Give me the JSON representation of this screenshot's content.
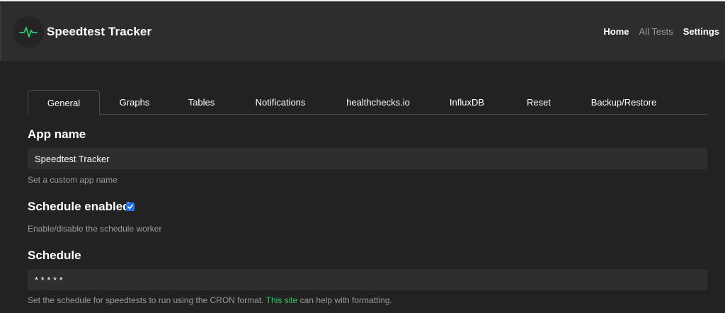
{
  "header": {
    "brand_title": "Speedtest Tracker",
    "logo_icon": "pulse-icon",
    "accent_color": "#2ecc71",
    "nav": [
      {
        "label": "Home",
        "active": true
      },
      {
        "label": "All Tests",
        "active": false
      },
      {
        "label": "Settings",
        "active": true
      }
    ]
  },
  "tabs": [
    {
      "label": "General",
      "active": true
    },
    {
      "label": "Graphs",
      "active": false
    },
    {
      "label": "Tables",
      "active": false
    },
    {
      "label": "Notifications",
      "active": false
    },
    {
      "label": "healthchecks.io",
      "active": false
    },
    {
      "label": "InfluxDB",
      "active": false
    },
    {
      "label": "Reset",
      "active": false
    },
    {
      "label": "Backup/Restore",
      "active": false
    }
  ],
  "form": {
    "app_name": {
      "title": "App name",
      "value": "Speedtest Tracker",
      "help": "Set a custom app name"
    },
    "schedule_enabled": {
      "title": "Schedule enabled",
      "checked": true,
      "help": "Enable/disable the schedule worker"
    },
    "schedule": {
      "title": "Schedule",
      "value": "* * * * *",
      "help_prefix": "Set the schedule for speedtests to run using the CRON format. ",
      "help_link": "This site",
      "help_suffix": " can help with formatting."
    }
  }
}
